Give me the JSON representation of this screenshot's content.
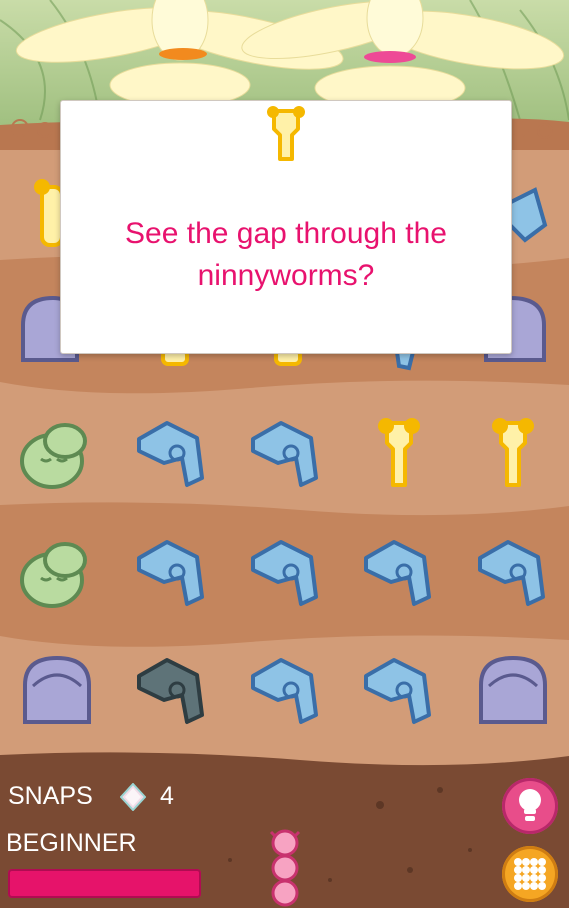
{
  "dialog": {
    "message_line1": "See the gap through the",
    "message_line2": "ninnyworms?"
  },
  "hud": {
    "snaps_label": "SNAPS",
    "snaps_count": "4",
    "level_label": "BEGINNER",
    "progress": 1.0
  },
  "board": {
    "rows": [
      [
        "bone",
        "hidden",
        "hidden",
        "hidden",
        "blue"
      ],
      [
        "grey",
        "hidden",
        "hidden",
        "hidden",
        "grey"
      ],
      [
        "green",
        "blue",
        "blue",
        "bone",
        "bone"
      ],
      [
        "green",
        "blue",
        "blue",
        "blue",
        "blue"
      ],
      [
        "grey",
        "dark-blue",
        "blue",
        "blue",
        "grey"
      ]
    ]
  },
  "colors": {
    "accent": "#e8126e",
    "pink_button": "#e84d8a",
    "orange_button": "#f5a623",
    "soil_light": "#d29c78",
    "soil_dark": "#b8764f"
  },
  "icons": {
    "hint_button": "hint-icon",
    "menu_button": "grid-menu-icon",
    "snaps_icon": "diamond-icon",
    "dialog_icon": "bone-piece-icon"
  }
}
